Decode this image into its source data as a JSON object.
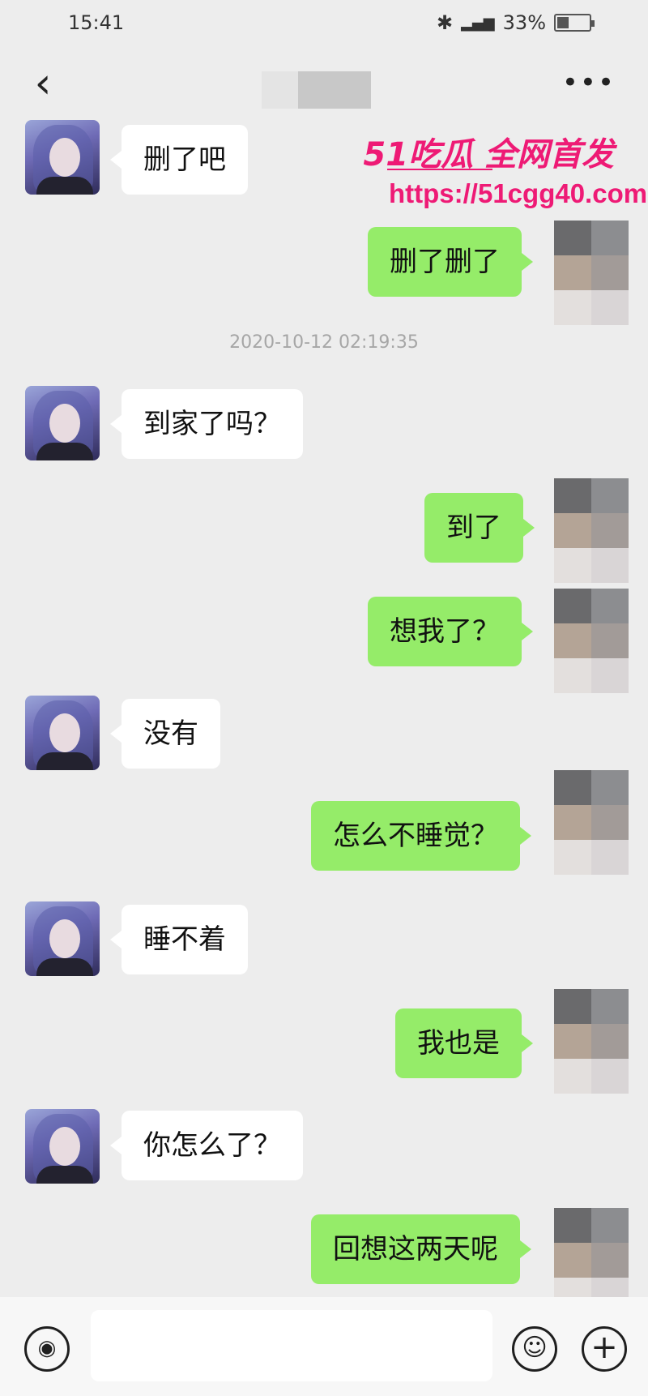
{
  "status_bar": {
    "time": "15:41",
    "signal": "4G",
    "battery": "33%"
  },
  "header": {
    "back_icon": "chevron-left-icon",
    "more_icon": "more-dots-icon",
    "more_label": "•••"
  },
  "watermark": {
    "brand": "51吃瓜 全网首发",
    "url": "https://51cgg40.com"
  },
  "timestamp": "2020-10-12 02:19:35",
  "messages": [
    {
      "side": "in",
      "text": "删了吧"
    },
    {
      "side": "out",
      "text": "删了删了"
    },
    {
      "side": "in",
      "text": "到家了吗？"
    },
    {
      "side": "out",
      "text": "到了"
    },
    {
      "side": "out",
      "text": "想我了？"
    },
    {
      "side": "in",
      "text": "没有"
    },
    {
      "side": "out",
      "text": "怎么不睡觉？"
    },
    {
      "side": "in",
      "text": "睡不着"
    },
    {
      "side": "out",
      "text": "我也是"
    },
    {
      "side": "in",
      "text": "你怎么了？"
    },
    {
      "side": "out",
      "text": "回想这两天呢"
    }
  ],
  "input_bar": {
    "voice_icon": "voice-icon",
    "emoji_icon": "emoji-icon",
    "plus_icon": "plus-icon",
    "placeholder": ""
  }
}
